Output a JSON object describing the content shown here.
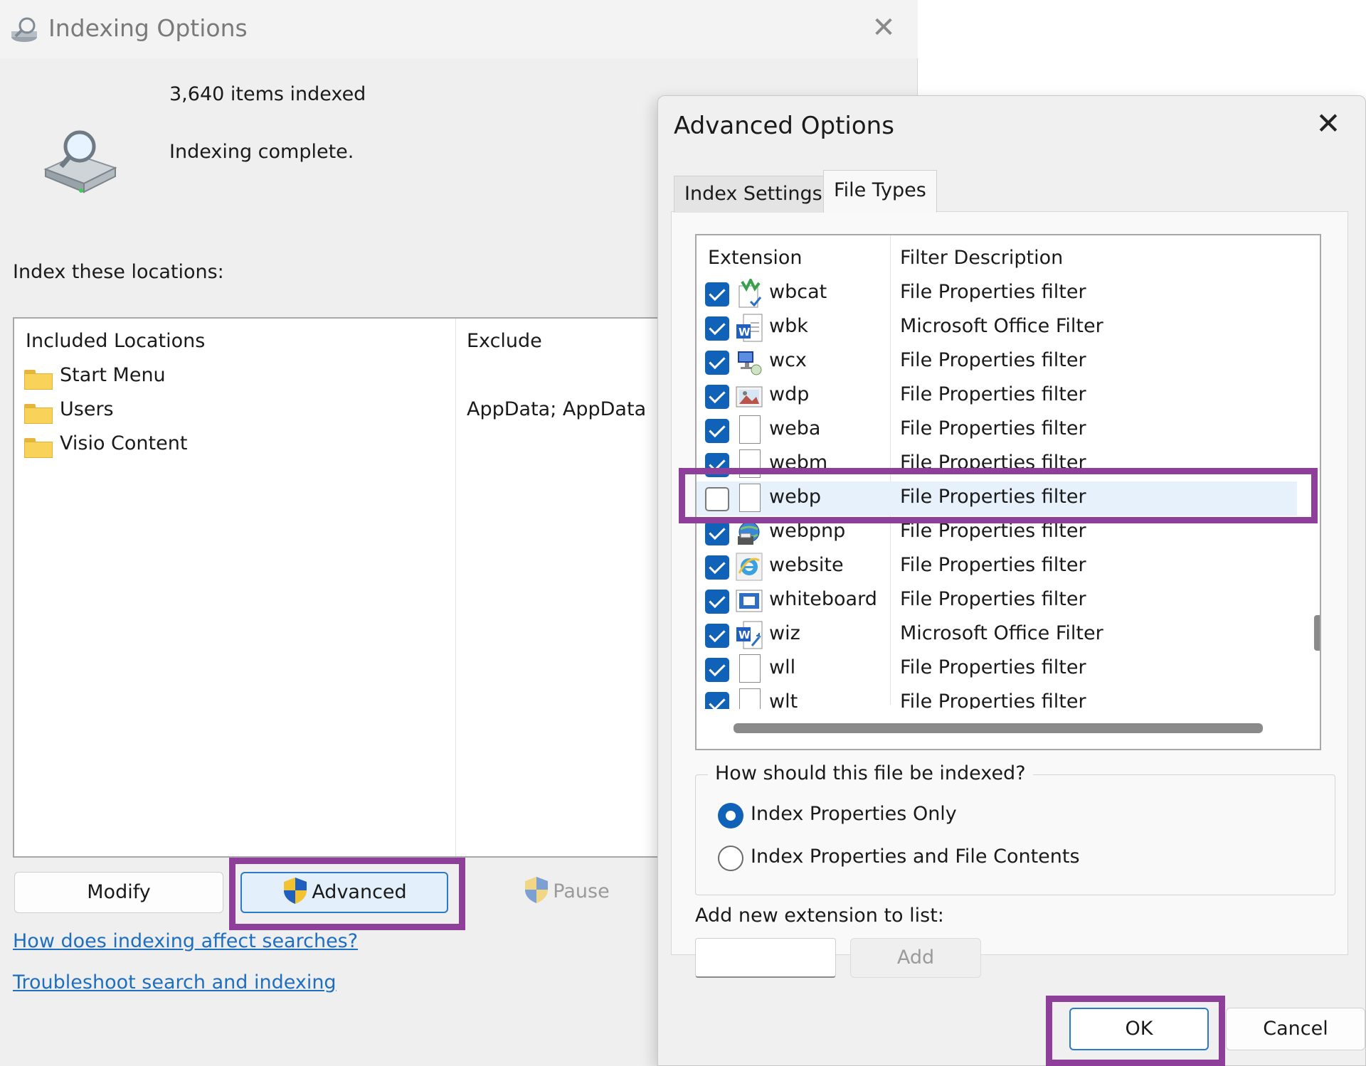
{
  "indexing_window": {
    "title": "Indexing Options",
    "close_glyph": "✕",
    "items_indexed": "3,640 items indexed",
    "status": "Indexing complete.",
    "index_label": "Index these locations:",
    "columns": {
      "included": "Included Locations",
      "exclude": "Exclude"
    },
    "locations": [
      {
        "name": "Start Menu",
        "exclude": ""
      },
      {
        "name": "Users",
        "exclude": "AppData; AppData"
      },
      {
        "name": "Visio Content",
        "exclude": ""
      }
    ],
    "buttons": {
      "modify": "Modify",
      "advanced": "Advanced",
      "pause": "Pause"
    },
    "links": {
      "how": "How does indexing affect searches?",
      "troubleshoot": "Troubleshoot search and indexing"
    }
  },
  "advanced_dialog": {
    "title": "Advanced Options",
    "close_glyph": "✕",
    "tabs": [
      "Index Settings",
      "File Types"
    ],
    "active_tab": "File Types",
    "columns": {
      "extension": "Extension",
      "description": "Filter Description"
    },
    "file_types": [
      {
        "ext": "wbcat",
        "desc": "File Properties filter",
        "checked": true,
        "icon": "catalog-icon"
      },
      {
        "ext": "wbk",
        "desc": "Microsoft Office Filter",
        "checked": true,
        "icon": "word-doc-icon"
      },
      {
        "ext": "wcx",
        "desc": "File Properties filter",
        "checked": true,
        "icon": "remote-connection-icon"
      },
      {
        "ext": "wdp",
        "desc": "File Properties filter",
        "checked": true,
        "icon": "image-file-icon"
      },
      {
        "ext": "weba",
        "desc": "File Properties filter",
        "checked": true,
        "icon": "blank-file-icon"
      },
      {
        "ext": "webm",
        "desc": "File Properties filter",
        "checked": true,
        "icon": "blank-file-icon"
      },
      {
        "ext": "webp",
        "desc": "File Properties filter",
        "checked": false,
        "icon": "blank-file-icon",
        "selected": true
      },
      {
        "ext": "webpnp",
        "desc": "File Properties filter",
        "checked": true,
        "icon": "web-printer-icon"
      },
      {
        "ext": "website",
        "desc": "File Properties filter",
        "checked": true,
        "icon": "internet-explorer-icon"
      },
      {
        "ext": "whiteboard",
        "desc": "File Properties filter",
        "checked": true,
        "icon": "whiteboard-icon"
      },
      {
        "ext": "wiz",
        "desc": "Microsoft Office Filter",
        "checked": true,
        "icon": "word-wizard-icon"
      },
      {
        "ext": "wll",
        "desc": "File Properties filter",
        "checked": true,
        "icon": "blank-file-icon"
      },
      {
        "ext": "wlt",
        "desc": "File Properties filter",
        "checked": true,
        "icon": "blank-file-icon"
      }
    ],
    "index_group_label": "How should this file be indexed?",
    "radio_options": [
      "Index Properties Only",
      "Index Properties and File Contents"
    ],
    "selected_radio": "Index Properties Only",
    "add_extension_label": "Add new extension to list:",
    "add_extension_value": "",
    "buttons": {
      "add": "Add",
      "ok": "OK",
      "cancel": "Cancel"
    }
  },
  "highlight_color": "#8e3f99",
  "accent_color": "#0f62b8"
}
